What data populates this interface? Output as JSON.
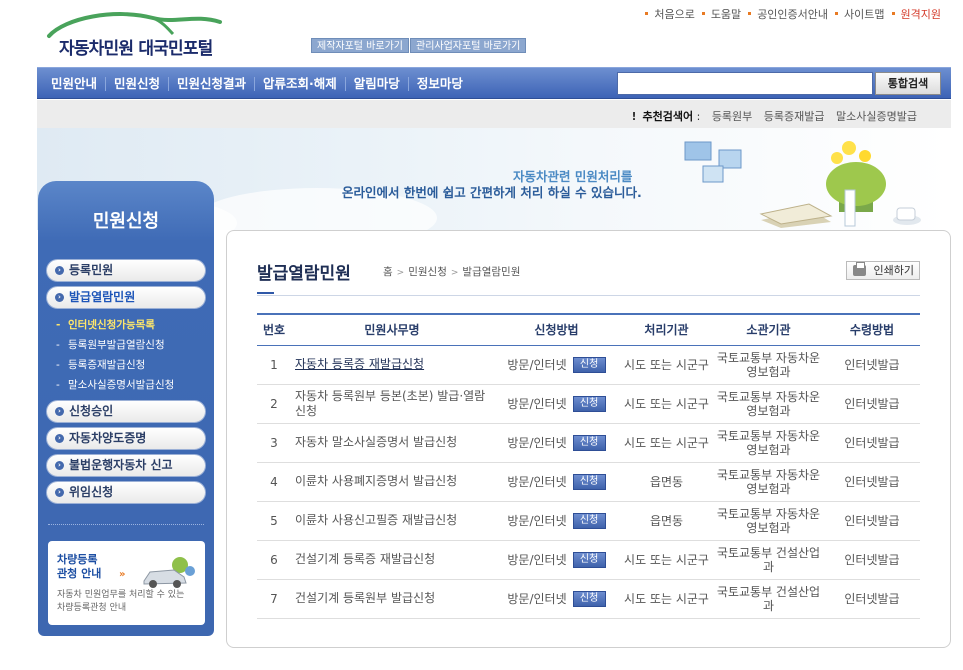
{
  "header": {
    "logo_text": "자동차민원 대국민포털",
    "quick_links": [
      "제작자포털 바로가기",
      "관리사업자포털 바로가기"
    ],
    "util_links": [
      "처음으로",
      "도움말",
      "공인인증서안내",
      "사이트맵",
      "원격지원"
    ]
  },
  "nav": {
    "items": [
      "민원안내",
      "민원신청",
      "민원신청결과",
      "압류조회·해제",
      "알림마당",
      "정보마당"
    ],
    "search_placeholder": "",
    "search_button": "통합검색"
  },
  "recommend": {
    "label": "추천검색어",
    "separator": ":",
    "keywords": [
      "등록원부",
      "등록증재발급",
      "말소사실증명발급"
    ]
  },
  "banner": {
    "line1": "자동차관련 민원처리를",
    "line2": "온라인에서 한번에 쉽고 간편하게 처리 하실 수 있습니다."
  },
  "sidebar": {
    "title": "민원신청",
    "items": [
      {
        "label": "등록민원"
      },
      {
        "label": "발급열람민원",
        "active": true
      },
      {
        "label": "신청승인"
      },
      {
        "label": "자동차양도증명"
      },
      {
        "label": "불법운행자동차 신고"
      },
      {
        "label": "위임신청"
      }
    ],
    "subitems": [
      "인터넷신청가능목록",
      "등록원부발급열람신청",
      "등록증재발급신청",
      "말소사실증명서발급신청"
    ],
    "promo": {
      "title1": "차량등록",
      "title2": "관청 안내",
      "arrow": "»",
      "desc1": "자동차 민원업무를 처리할 수 있는",
      "desc2": "차량등록관청 안내"
    }
  },
  "content": {
    "title": "발급열람민원",
    "breadcrumb": [
      "홈",
      "민원신청",
      "발급열람민원"
    ],
    "print_label": "인쇄하기",
    "columns": [
      "번호",
      "민원사무명",
      "신청방법",
      "처리기관",
      "소관기관",
      "수령방법"
    ],
    "apply_label": "신청",
    "rows": [
      {
        "no": "1",
        "name": "자동차 등록증 재발급신청",
        "method": "방문/인터넷",
        "proc": "시도 또는 시군구",
        "org": "국토교통부 자동차운영보험과",
        "recv": "인터넷발급",
        "link": true
      },
      {
        "no": "2",
        "name": "자동차 등록원부 등본(초본) 발급·열람신청",
        "method": "방문/인터넷",
        "proc": "시도 또는 시군구",
        "org": "국토교통부 자동차운영보험과",
        "recv": "인터넷발급",
        "link": false
      },
      {
        "no": "3",
        "name": "자동차 말소사실증명서 발급신청",
        "method": "방문/인터넷",
        "proc": "시도 또는 시군구",
        "org": "국토교통부 자동차운영보험과",
        "recv": "인터넷발급",
        "link": false
      },
      {
        "no": "4",
        "name": "이륜차 사용폐지증명서 발급신청",
        "method": "방문/인터넷",
        "proc": "읍면동",
        "org": "국토교통부 자동차운영보험과",
        "recv": "인터넷발급",
        "link": false
      },
      {
        "no": "5",
        "name": "이륜차 사용신고필증 재발급신청",
        "method": "방문/인터넷",
        "proc": "읍면동",
        "org": "국토교통부 자동차운영보험과",
        "recv": "인터넷발급",
        "link": false
      },
      {
        "no": "6",
        "name": "건설기계 등록증 재발급신청",
        "method": "방문/인터넷",
        "proc": "시도 또는 시군구",
        "org": "국토교통부 건설산업과",
        "recv": "인터넷발급",
        "link": false
      },
      {
        "no": "7",
        "name": "건설기계 등록원부 발급신청",
        "method": "방문/인터넷",
        "proc": "시도 또는 시군구",
        "org": "국토교통부 건설산업과",
        "recv": "인터넷발급",
        "link": false
      }
    ]
  },
  "colors": {
    "nav_blue": "#3d63b6",
    "accent_orange": "#e87a23",
    "sidebar_blue": "#3f6bb6"
  }
}
